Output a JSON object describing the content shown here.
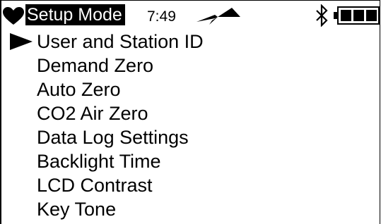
{
  "status_bar": {
    "mode_title": "Setup Mode",
    "time": "7:49",
    "icons": {
      "status": "heart-icon",
      "signal": "signal-icon",
      "bluetooth": "bluetooth-icon",
      "battery": "battery-icon"
    }
  },
  "menu": {
    "selected_index": 0,
    "items": [
      {
        "label": "User and Station ID"
      },
      {
        "label": "Demand Zero"
      },
      {
        "label": "Auto Zero"
      },
      {
        "label": "CO2 Air Zero"
      },
      {
        "label": "Data Log Settings"
      },
      {
        "label": "Backlight Time"
      },
      {
        "label": "LCD Contrast"
      },
      {
        "label": "Key Tone"
      }
    ]
  },
  "colors": {
    "foreground": "#000000",
    "background": "#ffffff"
  }
}
